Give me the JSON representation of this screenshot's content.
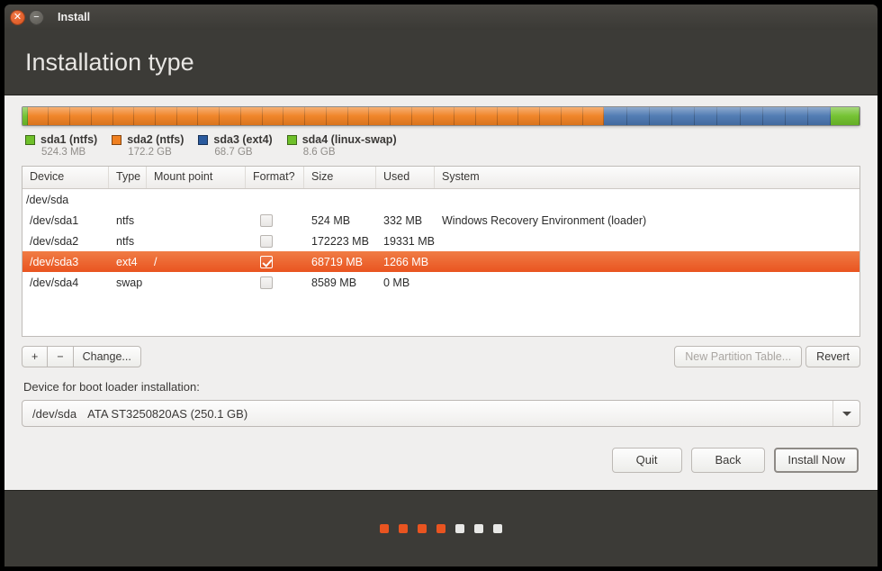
{
  "window": {
    "title": "Install",
    "close_icon": "close-icon",
    "minimize_icon": "minimize-icon"
  },
  "header": {
    "title": "Installation type"
  },
  "partition_bar": {
    "segments": [
      {
        "name": "sda1",
        "color": "#6fc02a",
        "percent": 0.6
      },
      {
        "name": "sda2",
        "color": "#f08020",
        "percent": 68.9
      },
      {
        "name": "sda3",
        "color": "#4a76b0",
        "percent": 27.1
      },
      {
        "name": "sda4",
        "color": "#6fc02a",
        "percent": 3.4
      }
    ]
  },
  "legend": [
    {
      "label": "sda1 (ntfs)",
      "size": "524.3 MB",
      "color": "#6fc02a"
    },
    {
      "label": "sda2 (ntfs)",
      "size": "172.2 GB",
      "color": "#f08020"
    },
    {
      "label": "sda3 (ext4)",
      "size": "68.7 GB",
      "color": "#2a5a9e"
    },
    {
      "label": "sda4 (linux-swap)",
      "size": "8.6 GB",
      "color": "#6fc02a"
    }
  ],
  "table": {
    "columns": [
      "Device",
      "Type",
      "Mount point",
      "Format?",
      "Size",
      "Used",
      "System"
    ],
    "rows": [
      {
        "kind": "disk",
        "device": "/dev/sda",
        "type": "",
        "mount": "",
        "format": null,
        "size": "",
        "used": "",
        "system": "",
        "selected": false
      },
      {
        "kind": "partition",
        "device": "/dev/sda1",
        "type": "ntfs",
        "mount": "",
        "format": false,
        "size": "524 MB",
        "used": "332 MB",
        "system": "Windows Recovery Environment (loader)",
        "selected": false
      },
      {
        "kind": "partition",
        "device": "/dev/sda2",
        "type": "ntfs",
        "mount": "",
        "format": false,
        "size": "172223 MB",
        "used": "19331 MB",
        "system": "",
        "selected": false
      },
      {
        "kind": "partition",
        "device": "/dev/sda3",
        "type": "ext4",
        "mount": "/",
        "format": true,
        "size": "68719 MB",
        "used": "1266 MB",
        "system": "",
        "selected": true
      },
      {
        "kind": "partition",
        "device": "/dev/sda4",
        "type": "swap",
        "mount": "",
        "format": false,
        "size": "8589 MB",
        "used": "0 MB",
        "system": "",
        "selected": false
      }
    ]
  },
  "toolbar": {
    "add_label": "+",
    "remove_label": "−",
    "change_label": "Change...",
    "new_partition_table_label": "New Partition Table...",
    "new_partition_table_disabled": true,
    "revert_label": "Revert"
  },
  "boot_loader": {
    "label": "Device for boot loader installation:",
    "selected_device": "/dev/sda",
    "selected_description": "ATA ST3250820AS (250.1 GB)",
    "dropdown_icon": "chevron-down-icon"
  },
  "actions": {
    "quit_label": "Quit",
    "back_label": "Back",
    "install_label": "Install Now"
  },
  "progress_dots": {
    "total": 7,
    "active": 4,
    "active_color": "#e95420",
    "inactive_color": "#e8e8e6"
  }
}
